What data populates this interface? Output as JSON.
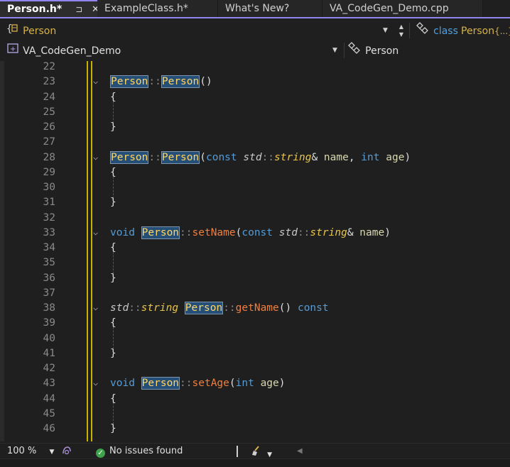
{
  "tabs": [
    {
      "label": "Person.h*",
      "active": true,
      "pin": "⊐",
      "close": "✕"
    },
    {
      "label": "ExampleClass.h*",
      "active": false
    },
    {
      "label": "What's New?",
      "active": false
    },
    {
      "label": "VA_CodeGen_Demo.cpp",
      "active": false
    }
  ],
  "nav": {
    "scope_label": "Person",
    "class_prefix": "class",
    "class_name": "Person",
    "class_suffix": "{...}",
    "project_label": "VA_CodeGen_Demo",
    "member_label": "Person"
  },
  "editor": {
    "lines": [
      {
        "n": "22"
      },
      {
        "n": "23",
        "fold": "⌵"
      },
      {
        "n": "24"
      },
      {
        "n": "25"
      },
      {
        "n": "26"
      },
      {
        "n": "27"
      },
      {
        "n": "28",
        "fold": "⌵"
      },
      {
        "n": "29"
      },
      {
        "n": "30"
      },
      {
        "n": "31"
      },
      {
        "n": "32"
      },
      {
        "n": "33",
        "fold": "⌵"
      },
      {
        "n": "34"
      },
      {
        "n": "35"
      },
      {
        "n": "36"
      },
      {
        "n": "37"
      },
      {
        "n": "38",
        "fold": "⌵"
      },
      {
        "n": "39"
      },
      {
        "n": "40"
      },
      {
        "n": "41"
      },
      {
        "n": "42"
      },
      {
        "n": "43",
        "fold": "⌵"
      },
      {
        "n": "44"
      },
      {
        "n": "45"
      },
      {
        "n": "46"
      }
    ],
    "code": {
      "class_name": "Person",
      "scope_op": "::",
      "open_paren": "(",
      "close_paren": ")",
      "empty_parens": "()",
      "open_brace": "{",
      "close_brace": "}",
      "kw_const": "const",
      "kw_int": "int",
      "kw_void": "void",
      "ns_std": "std",
      "type_string": "string",
      "amp": "&",
      "comma": ",",
      "param_name": "name",
      "param_age": "age",
      "fn_setName": "setName",
      "fn_getName": "getName",
      "fn_setAge": "setAge"
    }
  },
  "status": {
    "zoom": "100 %",
    "issues": "No issues found"
  },
  "colors": {
    "accent": "#9184ee",
    "type": "#e8c449",
    "function": "#f07f3f",
    "keyword": "#569cd6",
    "ok": "#3fa34d"
  }
}
